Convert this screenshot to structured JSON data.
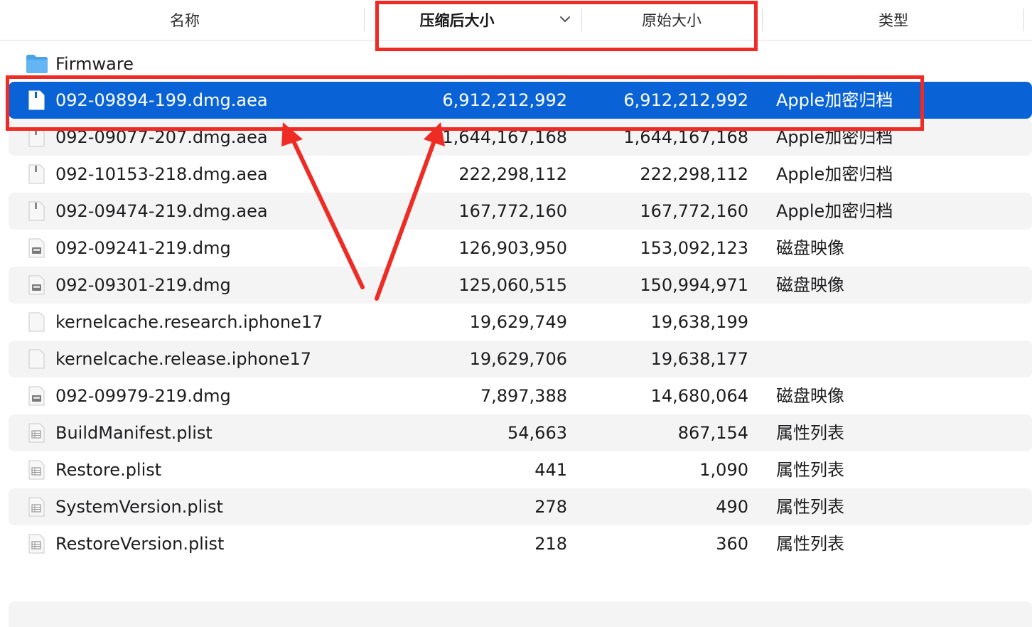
{
  "header": {
    "col_name": "名称",
    "col_compressed": "压缩后大小",
    "col_original": "原始大小",
    "col_kind": "类型"
  },
  "folder": {
    "name": "Firmware",
    "icon": "folder-icon"
  },
  "files": [
    {
      "name": "092-09894-199.dmg.aea",
      "compressed": "6,912,212,992",
      "original": "6,912,212,992",
      "kind": "Apple加密归档",
      "icon": "archive-file-icon",
      "selected": true
    },
    {
      "name": "092-09077-207.dmg.aea",
      "compressed": "1,644,167,168",
      "original": "1,644,167,168",
      "kind": "Apple加密归档",
      "icon": "archive-file-icon"
    },
    {
      "name": "092-10153-218.dmg.aea",
      "compressed": "222,298,112",
      "original": "222,298,112",
      "kind": "Apple加密归档",
      "icon": "archive-file-icon"
    },
    {
      "name": "092-09474-219.dmg.aea",
      "compressed": "167,772,160",
      "original": "167,772,160",
      "kind": "Apple加密归档",
      "icon": "archive-file-icon"
    },
    {
      "name": "092-09241-219.dmg",
      "compressed": "126,903,950",
      "original": "153,092,123",
      "kind": "磁盘映像",
      "icon": "disk-image-icon"
    },
    {
      "name": "092-09301-219.dmg",
      "compressed": "125,060,515",
      "original": "150,994,971",
      "kind": "磁盘映像",
      "icon": "disk-image-icon"
    },
    {
      "name": "kernelcache.research.iphone17",
      "compressed": "19,629,749",
      "original": "19,638,199",
      "kind": "",
      "icon": "blank-file-icon"
    },
    {
      "name": "kernelcache.release.iphone17",
      "compressed": "19,629,706",
      "original": "19,638,177",
      "kind": "",
      "icon": "blank-file-icon"
    },
    {
      "name": "092-09979-219.dmg",
      "compressed": "7,897,388",
      "original": "14,680,064",
      "kind": "磁盘映像",
      "icon": "disk-image-icon"
    },
    {
      "name": "BuildManifest.plist",
      "compressed": "54,663",
      "original": "867,154",
      "kind": "属性列表",
      "icon": "plist-file-icon"
    },
    {
      "name": "Restore.plist",
      "compressed": "441",
      "original": "1,090",
      "kind": "属性列表",
      "icon": "plist-file-icon"
    },
    {
      "name": "SystemVersion.plist",
      "compressed": "278",
      "original": "490",
      "kind": "属性列表",
      "icon": "plist-file-icon"
    },
    {
      "name": "RestoreVersion.plist",
      "compressed": "218",
      "original": "360",
      "kind": "属性列表",
      "icon": "plist-file-icon"
    }
  ],
  "colors": {
    "selection": "#0a63d6",
    "annotation": "#ee2b24",
    "row_alt": "#f4f4f5",
    "folder": "#4aa3e8"
  }
}
